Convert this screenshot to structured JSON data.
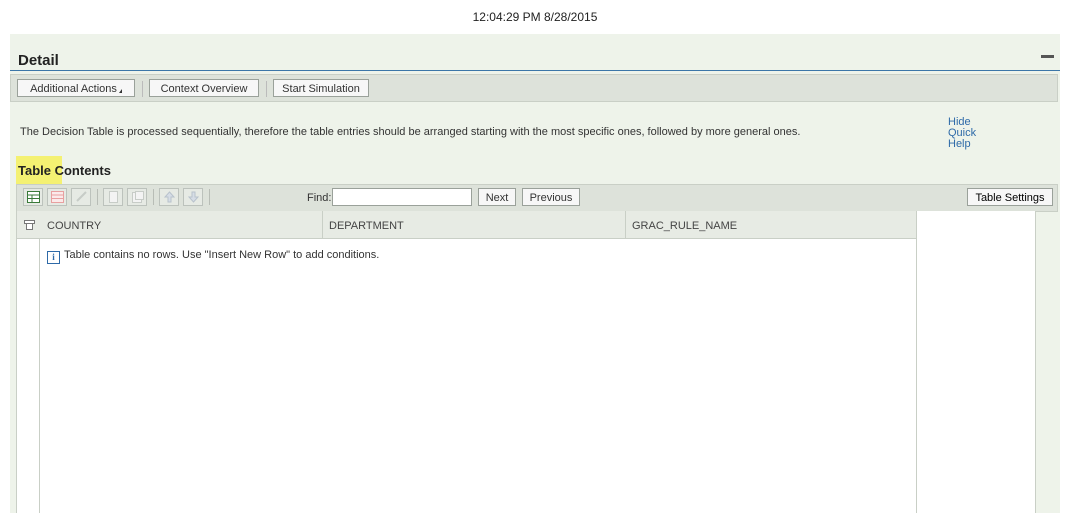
{
  "timestamp": "12:04:29 PM 8/28/2015",
  "panel": {
    "title": "Detail",
    "actions": {
      "additional_actions": "Additional Actions",
      "context_overview": "Context Overview",
      "start_simulation": "Start Simulation"
    },
    "help_text": "The Decision Table is processed sequentially, therefore the table entries should be arranged starting with the most specific ones, followed by more general ones.",
    "quick_help": [
      "Hide",
      "Quick",
      "Help"
    ]
  },
  "table": {
    "section_title": "Table Contents",
    "toolbar": {
      "icons": [
        "insert-row-icon",
        "delete-row-icon",
        "edit-icon",
        "copy-icon",
        "paste-icon",
        "move-up-icon",
        "move-down-icon"
      ],
      "find_label": "Find:",
      "find_value": "",
      "next": "Next",
      "previous": "Previous",
      "settings": "Table Settings"
    },
    "columns": [
      "COUNTRY",
      "DEPARTMENT",
      "GRAC_RULE_NAME"
    ],
    "empty_message": "Table contains no rows. Use \"Insert New Row\" to add conditions.",
    "rows": []
  },
  "colors": {
    "panel_bg": "#eef3ea",
    "header_rule": "#3c76a8",
    "link": "#2e6aa8",
    "highlight": "#f5f04a"
  }
}
